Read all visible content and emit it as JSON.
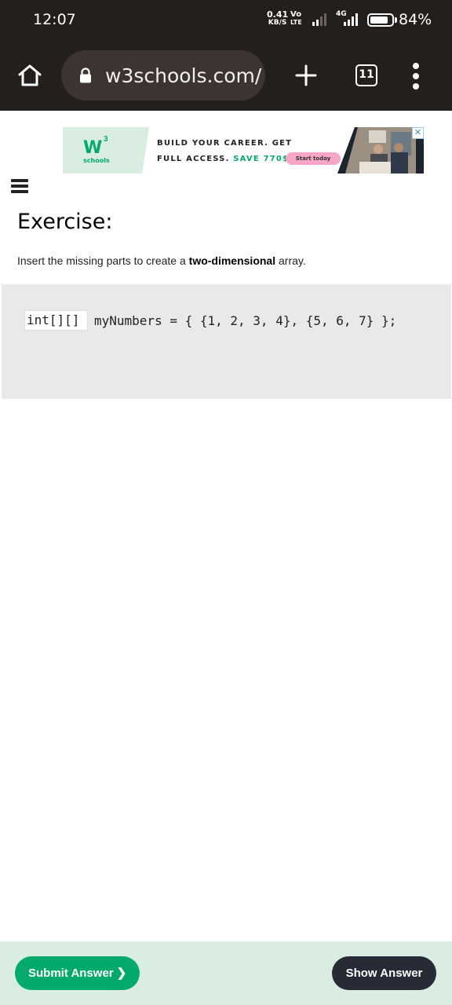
{
  "status_bar": {
    "time": "12:07",
    "speed_value": "0.41",
    "speed_unit": "KB/S",
    "volte_top": "Vo",
    "volte_bottom": "LTE",
    "network": "4G",
    "battery_percent": "84%",
    "battery_level": 0.84
  },
  "browser": {
    "url": "w3schools.com/",
    "tab_count": "11"
  },
  "ad": {
    "logo_mark": "W",
    "logo_sup": "3",
    "logo_name": "schools",
    "line1": "BUILD YOUR CAREER. GET",
    "line2_prefix": "FULL ACCESS. ",
    "line2_highlight": "SAVE 770$",
    "cta": "Start today",
    "close": "✕",
    "accent_color": "#04aa6d"
  },
  "exercise": {
    "title": "Exercise:",
    "description_prefix": "Insert the missing parts to create a ",
    "description_bold": "two-dimensional",
    "description_suffix": " array.",
    "input_value": "int[][]",
    "code_rest": "myNumbers = { {1, 2, 3, 4}, {5, 6, 7} };"
  },
  "actions": {
    "submit_label": "Submit Answer ❯",
    "show_label": "Show Answer"
  }
}
